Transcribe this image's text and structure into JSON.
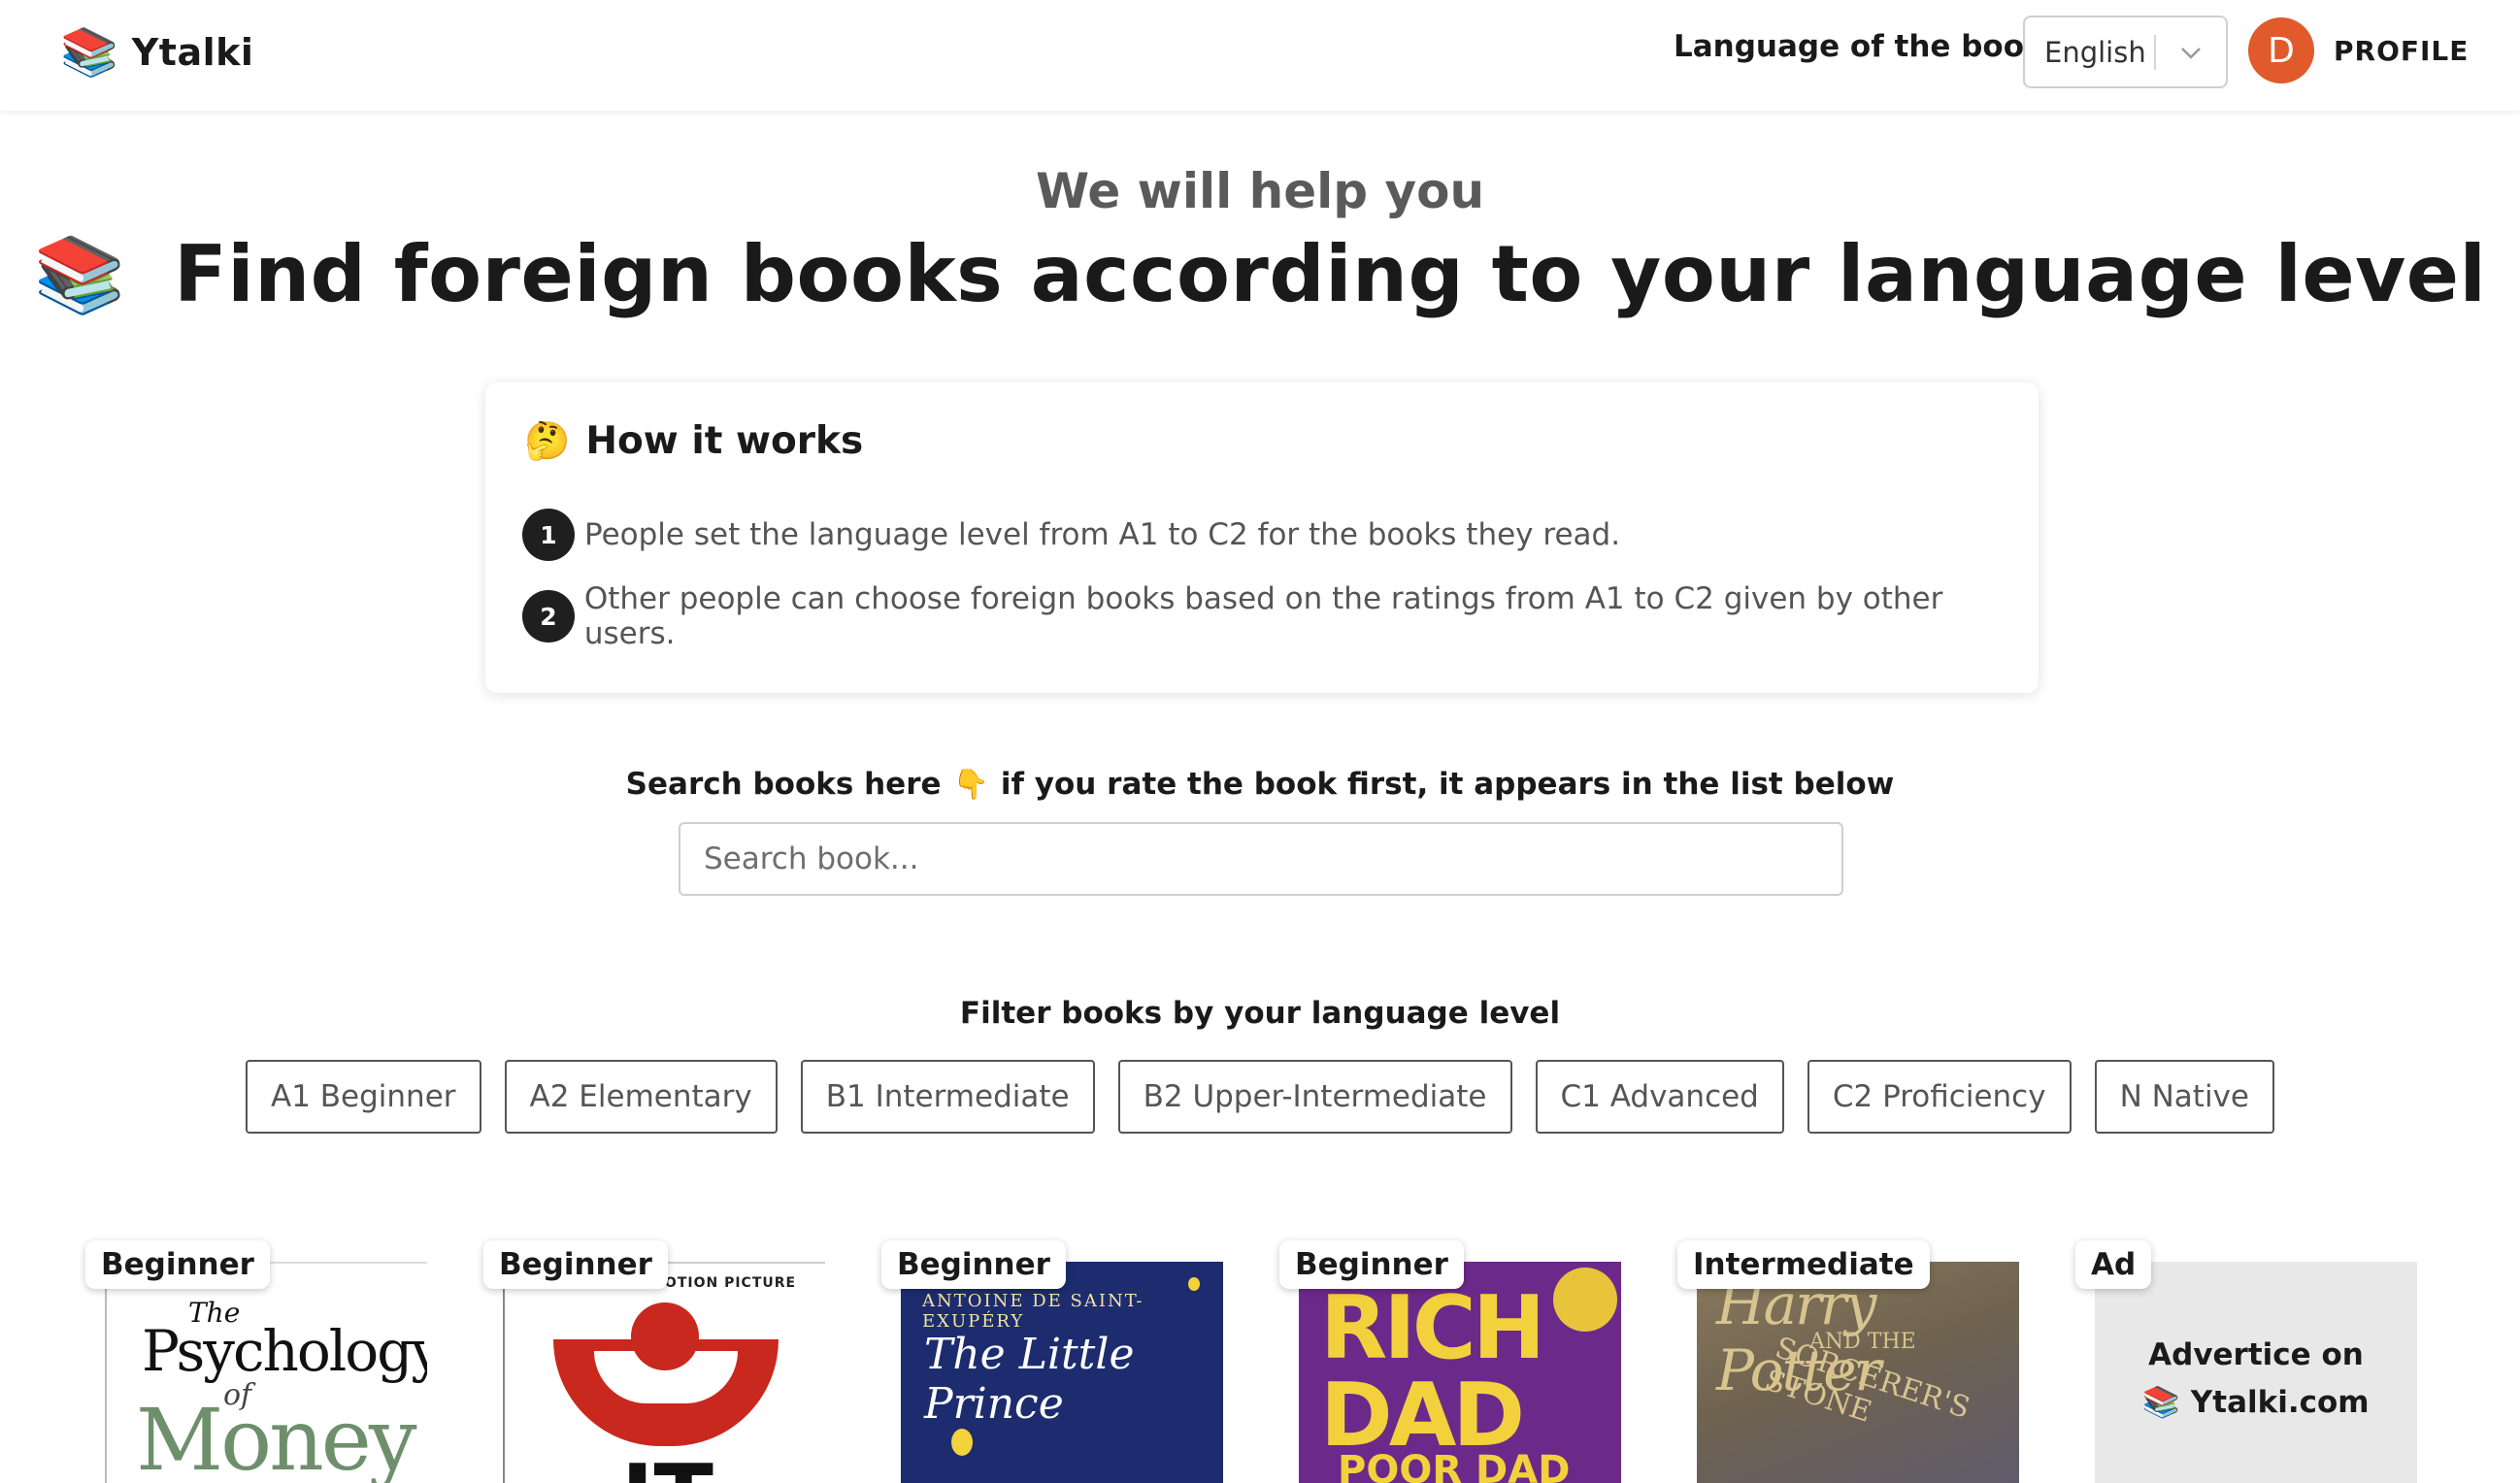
{
  "header": {
    "brand_icon": "📚",
    "brand_name": "Ytalki",
    "language_label": "Language of the books",
    "language_value": "English",
    "avatar_letter": "D",
    "avatar_color": "#e05a2b",
    "profile_label": "PROFILE"
  },
  "hero": {
    "subtitle": "We will help you",
    "icon": "📚",
    "title": "Find foreign books according to your language level"
  },
  "how_it_works": {
    "icon": "🤔",
    "title": "How it works",
    "steps": [
      {
        "num": "1",
        "text": "People set the language level from A1 to C2 for the books they read."
      },
      {
        "num": "2",
        "text": "Other people can choose foreign books based on the ratings from A1 to C2 given by other users."
      }
    ]
  },
  "search": {
    "label_before": "Search books here",
    "pointer_icon": "👇",
    "label_after": "if you rate the book first, it appears in the list below",
    "placeholder": "Search book..."
  },
  "filters": {
    "label": "Filter books by your language level",
    "options": [
      "A1 Beginner",
      "A2 Elementary",
      "B1 Intermediate",
      "B2 Upper-Intermediate",
      "C1 Advanced",
      "C2 Proficiency",
      "N Native"
    ]
  },
  "books": [
    {
      "badge": "Beginner",
      "cover_text": [
        "The",
        "Psychology",
        "of",
        "Money"
      ]
    },
    {
      "badge": "Beginner",
      "cover_text": [
        "MOTION PICTURE",
        "IT"
      ]
    },
    {
      "badge": "Beginner",
      "cover_text": [
        "ANTOINE DE SAINT-EXUPÉRY",
        "The Little Prince"
      ]
    },
    {
      "badge": "Beginner",
      "cover_text": [
        "RICH",
        "DAD",
        "POOR DAD"
      ]
    },
    {
      "badge": "Intermediate",
      "cover_text": [
        "Harry Potter",
        "AND THE",
        "SORCERER'S STONE"
      ]
    },
    {
      "badge": "Ad",
      "ad_line1": "Advertice on",
      "ad_icon": "📚",
      "ad_line2": "Ytalki.com"
    }
  ]
}
